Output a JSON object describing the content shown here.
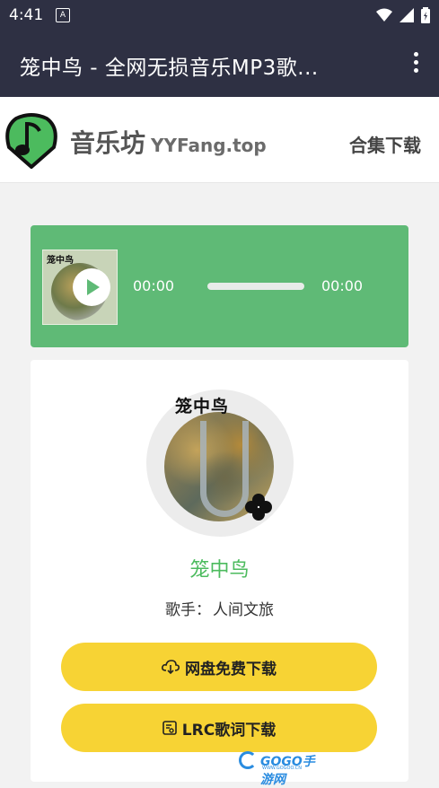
{
  "status_bar": {
    "time": "4:41",
    "notification_glyph": "A"
  },
  "app_bar": {
    "title": "笼中鸟 - 全网无损音乐MP3歌..."
  },
  "site": {
    "brand": "音乐坊",
    "domain": "YYFang.top",
    "nav_link": "合集下载"
  },
  "player": {
    "cover_label": "笼中鸟",
    "current_time": "00:00",
    "end_time": "00:00",
    "progress_fraction": 0
  },
  "song": {
    "cover_label": "笼中鸟",
    "title": "笼中鸟",
    "artist_label": "歌手：",
    "artist": "人间文旅"
  },
  "buttons": {
    "cloud_download": "网盘免费下载",
    "lrc_download": "LRC歌词下载"
  },
  "watermark": {
    "text": "GOGO手游网",
    "sub": "WWW.GOGOO.CN"
  },
  "colors": {
    "app_bar": "#2e3043",
    "player": "#5fba76",
    "title_green": "#4cbb5e",
    "button_yellow": "#f7d334"
  },
  "icons": [
    "notification-a-icon",
    "wifi-icon",
    "signal-icon",
    "battery-icon",
    "more-vert-icon",
    "music-note-logo-icon",
    "play-icon",
    "cloud-download-icon",
    "lyrics-icon",
    "clover-icon"
  ]
}
